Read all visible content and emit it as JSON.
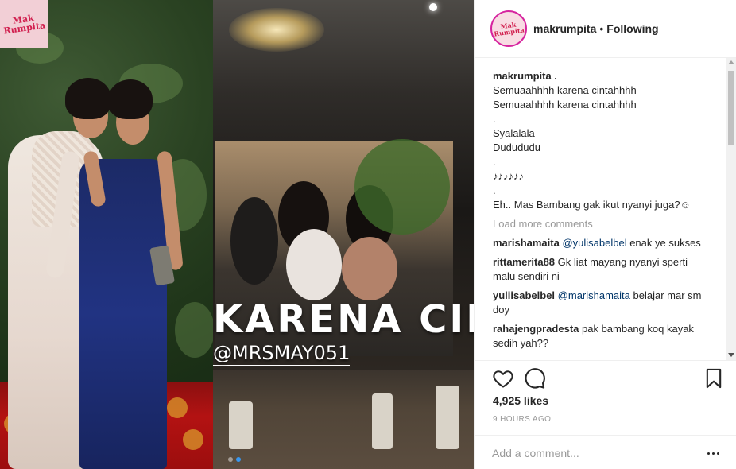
{
  "media": {
    "badge_text": "Mak Rumpita",
    "story_title": "KARENA CINTA",
    "story_handle": "@MRSMAY051",
    "carousel": {
      "count": 2,
      "active": 1
    }
  },
  "header": {
    "avatar_text": "Mak Rumpita",
    "username": "makrumpita",
    "separator": "•",
    "follow_status": "Following"
  },
  "caption": {
    "username": "makrumpita .",
    "lines": [
      "Semuaahhhh karena cintahhhh",
      "Semuaahhhh karena cintahhhh",
      ".",
      "Syalalala",
      "Dudududu",
      ".",
      "♪♪♪♪♪♪",
      ".",
      "Eh.. Mas Bambang gak ikut nyanyi juga?☺"
    ]
  },
  "load_more": "Load more comments",
  "comments": [
    {
      "user": "marishamaita",
      "mention": "@yulisabelbel",
      "text": " enak ye sukses"
    },
    {
      "user": "rittamerita88",
      "mention": "",
      "text": "Gk liat mayang nyanyi sperti malu sendiri ni"
    },
    {
      "user": "yuliisabelbel",
      "mention": "@marishamaita",
      "text": " belajar mar sm doy"
    },
    {
      "user": "rahajengpradesta",
      "mention": "",
      "text": "pak bambang koq kayak sedih yah??"
    }
  ],
  "actions": {
    "like_icon": "heart-icon",
    "comment_icon": "speech-bubble-icon",
    "save_icon": "bookmark-icon"
  },
  "likes": "4,925 likes",
  "timestamp": "9 HOURS AGO",
  "add_comment": {
    "placeholder": "Add a comment...",
    "more_icon": "ellipsis-icon"
  },
  "colors": {
    "link": "#003569",
    "muted": "#999999",
    "text": "#262626",
    "active_dot": "#3897f0"
  }
}
